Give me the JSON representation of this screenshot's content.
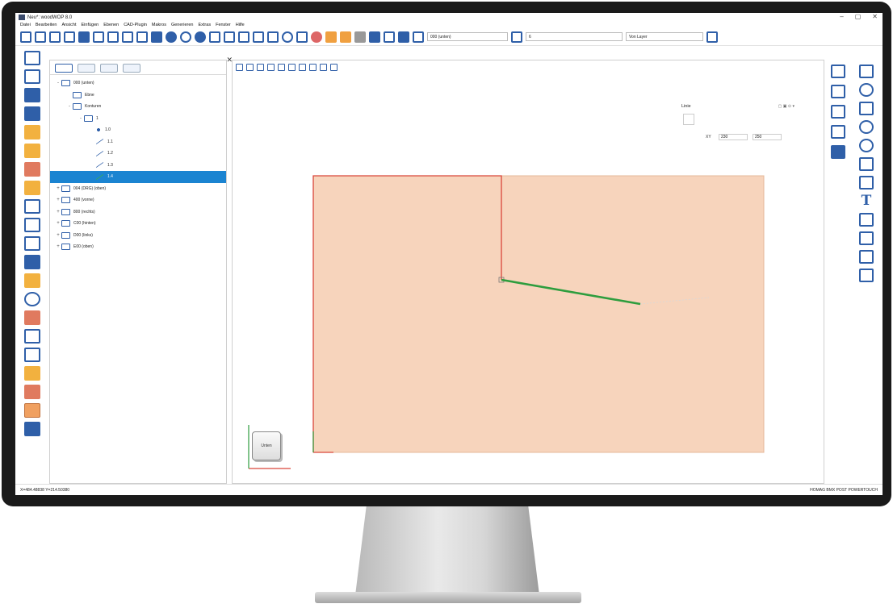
{
  "window": {
    "title": "Neu*: woodWOP 8.0",
    "controls": [
      "–",
      "▢",
      "✕"
    ]
  },
  "menu": [
    "Datei",
    "Bearbeiten",
    "Ansicht",
    "Einfügen",
    "Ebenen",
    "CAD-Plugin",
    "Makros",
    "Generieren",
    "Extras",
    "Fenster",
    "Hilfe"
  ],
  "toolbar": {
    "layer_select": "000 (unten)",
    "color_select": "6",
    "layer_filter": "Von Layer"
  },
  "tree": {
    "items": [
      {
        "label": "000 (unten)",
        "expander": "-",
        "icon": "workpiece-icon",
        "indent": 0
      },
      {
        "label": "Ebne",
        "expander": "",
        "icon": "plane-icon",
        "indent": 1
      },
      {
        "label": "Konturen",
        "expander": "-",
        "icon": "contour-icon",
        "indent": 1
      },
      {
        "label": "1",
        "expander": "-",
        "icon": "contour-icon",
        "indent": 2
      },
      {
        "label": "1.0",
        "expander": "",
        "icon": "point-icon",
        "indent": 3
      },
      {
        "label": "1.1",
        "expander": "",
        "icon": "line-icon",
        "indent": 3
      },
      {
        "label": "1.2",
        "expander": "",
        "icon": "line-icon",
        "indent": 3
      },
      {
        "label": "1.3",
        "expander": "",
        "icon": "line-icon",
        "indent": 3
      },
      {
        "label": "1.4",
        "expander": "",
        "icon": "line-icon",
        "indent": 3,
        "selected": true
      },
      {
        "label": "004 (DRG) (oben)",
        "expander": "+",
        "icon": "workpiece-icon",
        "indent": 0
      },
      {
        "label": "400 (vorne)",
        "expander": "+",
        "icon": "workpiece-icon",
        "indent": 0
      },
      {
        "label": "800 (rechts)",
        "expander": "+",
        "icon": "workpiece-icon",
        "indent": 0
      },
      {
        "label": "C00 (hinten)",
        "expander": "+",
        "icon": "workpiece-icon",
        "indent": 0
      },
      {
        "label": "D00 (links)",
        "expander": "+",
        "icon": "workpiece-icon",
        "indent": 0
      },
      {
        "label": "E00 (oben)",
        "expander": "+",
        "icon": "workpiece-icon",
        "indent": 0
      }
    ]
  },
  "properties": {
    "title": "Linie",
    "label_xy": "XY",
    "x_value": "230",
    "y_value": "250"
  },
  "view_cube": {
    "label": "Unten"
  },
  "statusbar": {
    "coords": "X=484.48838 Y=214.50380",
    "right": "HOMAG BMX POST POWERTOUCH"
  },
  "colors": {
    "workpiece_fill": "#f7d4bc",
    "contour_red": "#d9463a",
    "selected_line": "#2e9d3e",
    "accent": "#2f5fa8",
    "selection": "#1b84d1"
  }
}
